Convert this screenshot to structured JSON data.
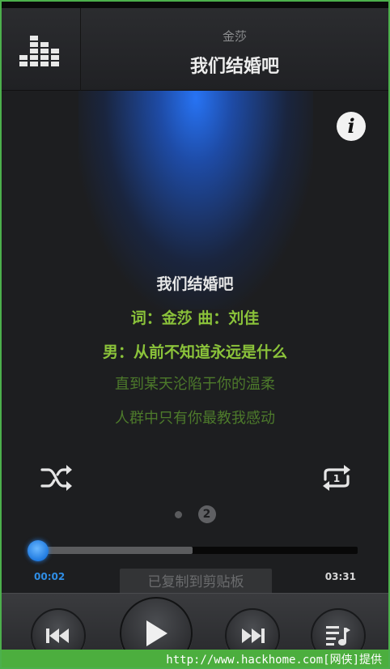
{
  "header": {
    "artist": "金莎",
    "song_title": "我们结婚吧",
    "equalizer_icon": "equalizer-icon"
  },
  "info_icon": {
    "glyph": "i",
    "name": "info-icon"
  },
  "lyrics": {
    "title": "我们结婚吧",
    "credit": "词：金莎 曲：刘佳",
    "current_line": "男：从前不知道永远是什么",
    "next_line_1": "直到某天沦陷于你的温柔",
    "next_line_2": "人群中只有你最教我感动"
  },
  "modes": {
    "shuffle_icon": "shuffle-icon",
    "repeat_icon": "repeat-one-icon",
    "repeat_badge": "1"
  },
  "pager": {
    "pages": 2,
    "current": "2"
  },
  "playback": {
    "current_time": "00:02",
    "total_time": "03:31",
    "progress": 0.01,
    "buffered": 0.49
  },
  "toast": "已复制到剪贴板",
  "controls": {
    "prev_icon": "previous-icon",
    "play_icon": "play-icon",
    "next_icon": "next-icon",
    "playlist_icon": "playlist-icon"
  },
  "watermark": "http://www.hackhome.com[网侠]提供",
  "colors": {
    "accent_blue": "#2b86d9",
    "lyric_green": "#8bc33a",
    "lyric_dim_green": "#4d7a2b",
    "watermark_green": "#4cae3e"
  }
}
